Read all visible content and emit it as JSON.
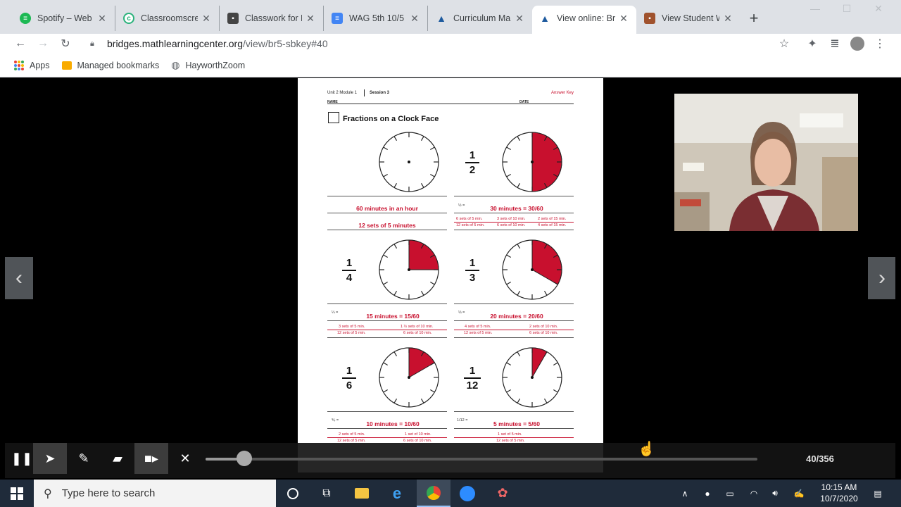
{
  "browser": {
    "tabs": [
      {
        "title": "Spotify – Web P",
        "favicon": "spotify-icon",
        "color": "#1db954"
      },
      {
        "title": "Classroomscree",
        "favicon": "classroomscreen-icon",
        "color": "#2ab27b"
      },
      {
        "title": "Classwork for H",
        "favicon": "classroom-icon",
        "color": "#444444"
      },
      {
        "title": "WAG 5th 10/5",
        "favicon": "docs-icon",
        "color": "#4285f4"
      },
      {
        "title": "Curriculum Ma",
        "favicon": "mlc-icon",
        "color": "#1d5a9e"
      },
      {
        "title": "View online: Bri",
        "favicon": "mlc-icon",
        "color": "#1d5a9e"
      },
      {
        "title": "View Student W",
        "favicon": "student-work-icon",
        "color": "#a0522d"
      }
    ],
    "url_host": "bridges.mathlearningcenter.org",
    "url_path": "/view/br5-sbkey#40",
    "bookmarks": [
      {
        "label": "Apps",
        "icon": "apps-grid-icon"
      },
      {
        "label": "Managed bookmarks",
        "icon": "folder-icon"
      },
      {
        "label": "HayworthZoom",
        "icon": "globe-icon"
      }
    ]
  },
  "worksheet": {
    "unit": "Unit 2 Module 1",
    "session": "Session 3",
    "answer_key": "Answer Key",
    "name_label": "NAME",
    "date_label": "DATE",
    "title": "Fractions on a Clock Face",
    "whole_hour": "60 minutes in an hour",
    "whole_sets": "12 sets of 5 minutes",
    "half_num": "1",
    "half_den": "2",
    "half_answer": "30 minutes = 30/60",
    "half_sets": [
      "6 sets of 5 min.",
      "12 sets of 5 min.",
      "3 sets of 10 min.",
      "6 sets of 10 min.",
      "2 sets of 15 min.",
      "4 sets of 15 min."
    ],
    "quarter_num": "1",
    "quarter_den": "4",
    "quarter_answer": "15 minutes = 15/60",
    "quarter_sets": [
      "3 sets of 5 min.",
      "12 sets of 5 min.",
      "1 ½ sets of 10 min.",
      "6 sets of 10 min."
    ],
    "third_num": "1",
    "third_den": "3",
    "third_answer": "20 minutes = 20/60",
    "third_sets": [
      "4 sets of 5 min.",
      "12 sets of 5 min.",
      "2 sets of 10 min.",
      "6 sets of 10 min."
    ],
    "sixth_num": "1",
    "sixth_den": "6",
    "sixth_answer": "10 minutes = 10/60",
    "sixth_sets": [
      "2 sets of 5 min.",
      "12 sets of 5 min.",
      "1 set of 10 min.",
      "6 sets of 10 min."
    ],
    "twelfth_num": "1",
    "twelfth_den": "12",
    "twelfth_answer": "5 minutes = 5/60",
    "twelfth_sets": [
      "1 set of 5 min.",
      "12 sets of 5 min."
    ],
    "eq_half": "½ =",
    "eq_quarter": "¼ =",
    "eq_third": "⅓ =",
    "eq_sixth": "⅙ =",
    "eq_twelfth": "1/12 ="
  },
  "player": {
    "counter": "40/356",
    "progress": 0.08
  },
  "taskbar": {
    "search_placeholder": "Type here to search",
    "time": "10:15 AM",
    "date": "10/7/2020"
  },
  "colors": {
    "accent_red": "#c8102e"
  }
}
